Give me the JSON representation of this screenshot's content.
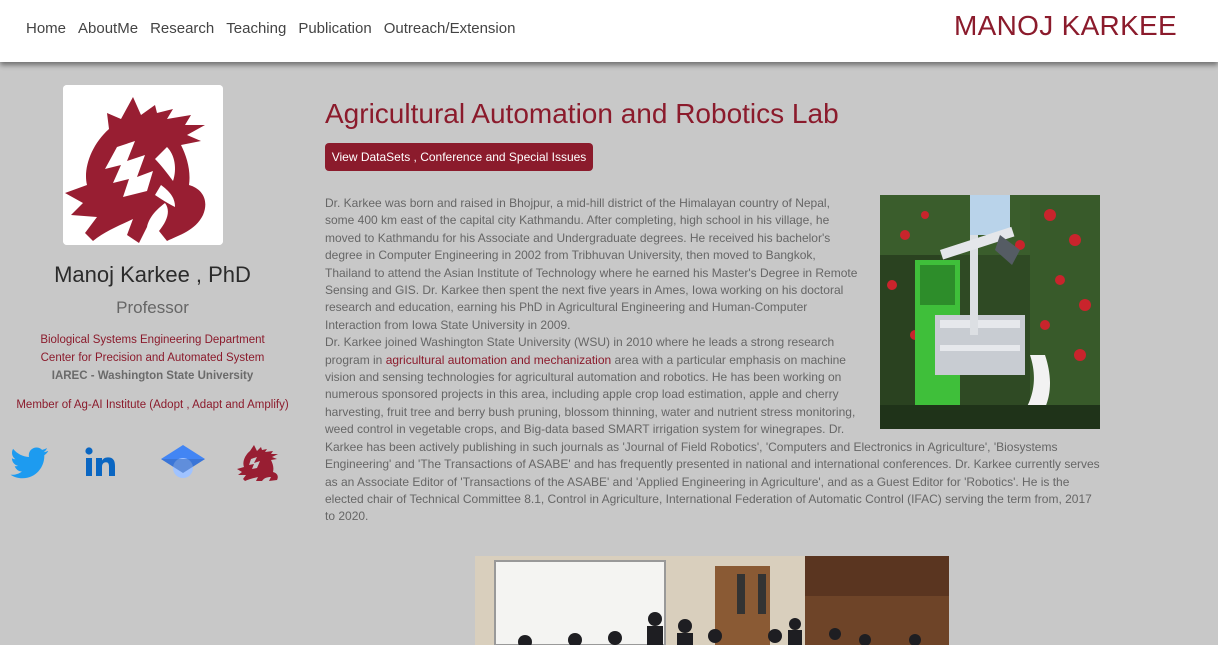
{
  "nav": {
    "links": [
      "Home",
      "AboutMe",
      "Research",
      "Teaching",
      "Publication",
      "Outreach/Extension"
    ],
    "brand": "MANOJ KARKEE"
  },
  "sidebar": {
    "name": "Manoj Karkee , PhD",
    "title": "Professor",
    "affiliations": [
      "Biological Systems Engineering Department",
      "Center for Precision and Automated System",
      "IAREC - Washington State University"
    ],
    "membership": "Member of Ag-AI Institute (Adopt , Adapt and Amplify)",
    "social_icons": [
      "twitter-icon",
      "linkedin-icon",
      "google-scholar-icon",
      "wsu-cougar-icon"
    ]
  },
  "main": {
    "title": "Agricultural Automation and Robotics Lab",
    "button_label": "View DataSets , Conference and Special Issues",
    "bio_p1": "Dr. Karkee was born and raised in Bhojpur, a mid-hill district of the Himalayan country of Nepal, some 400 km east of the capital city Kathmandu. After completing, high school in his village, he moved to Kathmandu for his Associate and Undergraduate degrees. He received his bachelor's degree in Computer Engineering in 2002 from Tribhuvan University, then moved to Bangkok, Thailand to attend the Asian Institute of Technology where he earned his Master's Degree in Remote Sensing and GIS. Dr. Karkee then spent the next five years in Ames, Iowa working on his doctoral research and education, earning his PhD in Agricultural Engineering and Human-Computer Interaction from Iowa State University in 2009.",
    "bio_p2_before": "Dr. Karkee joined Washington State University (WSU) in 2010 where he leads a strong research program in ",
    "bio_p2_link": "agricultural automation and mechanization",
    "bio_p2_after": " area with a particular emphasis on machine vision and sensing technologies for agricultural automation and robotics. He has been working on numerous sponsored projects in this area, including apple crop load estimation, apple and cherry harvesting, fruit tree and berry bush pruning, blossom thinning, water and nutrient stress monitoring, weed control in vegetable crops, and Big-data based SMART irrigation system for winegrapes. Dr. Karkee has been actively publishing in such journals as 'Journal of Field Robotics', 'Computers and Electronics in Agriculture', 'Biosystems Engineering' and 'The Transactions of ASABE' and has frequently presented in national and international conferences. Dr. Karkee currently serves as an Associate Editor of 'Transactions of the ASABE' and 'Applied Engineering in Agriculture', and as a Guest Editor for 'Robotics'. He is the elected chair of Technical Committee 8.1, Control in Agriculture, International Federation of Automatic Control (IFAC) serving the term from, 2017 to 2020."
  },
  "colors": {
    "accent": "#8b1b2c",
    "background": "#c8c8c8",
    "navbar": "#ffffff",
    "twitter": "#1d9bf0",
    "linkedin": "#0a66c2"
  }
}
